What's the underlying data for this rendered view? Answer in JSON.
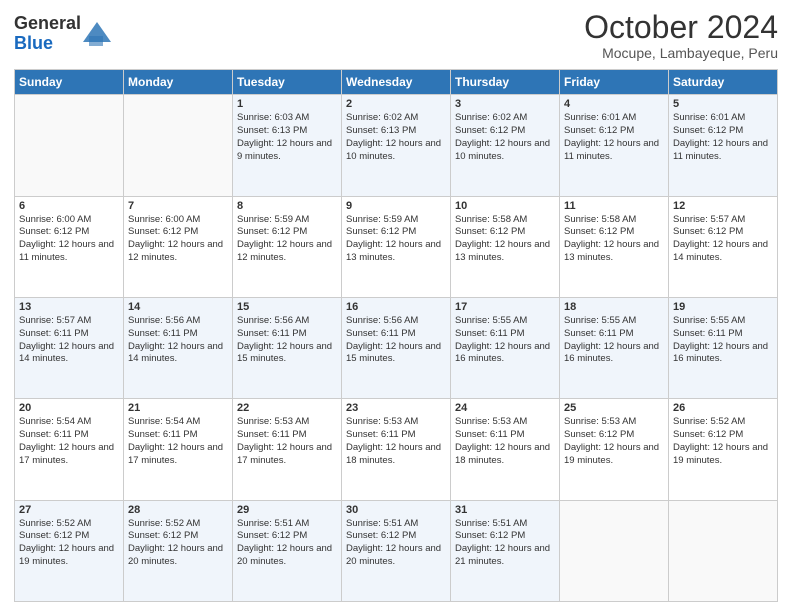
{
  "logo": {
    "general": "General",
    "blue": "Blue"
  },
  "header": {
    "title": "October 2024",
    "subtitle": "Mocupe, Lambayeque, Peru"
  },
  "weekdays": [
    "Sunday",
    "Monday",
    "Tuesday",
    "Wednesday",
    "Thursday",
    "Friday",
    "Saturday"
  ],
  "weeks": [
    [
      {
        "day": "",
        "info": ""
      },
      {
        "day": "",
        "info": ""
      },
      {
        "day": "1",
        "info": "Sunrise: 6:03 AM\nSunset: 6:13 PM\nDaylight: 12 hours and 9 minutes."
      },
      {
        "day": "2",
        "info": "Sunrise: 6:02 AM\nSunset: 6:13 PM\nDaylight: 12 hours and 10 minutes."
      },
      {
        "day": "3",
        "info": "Sunrise: 6:02 AM\nSunset: 6:12 PM\nDaylight: 12 hours and 10 minutes."
      },
      {
        "day": "4",
        "info": "Sunrise: 6:01 AM\nSunset: 6:12 PM\nDaylight: 12 hours and 11 minutes."
      },
      {
        "day": "5",
        "info": "Sunrise: 6:01 AM\nSunset: 6:12 PM\nDaylight: 12 hours and 11 minutes."
      }
    ],
    [
      {
        "day": "6",
        "info": "Sunrise: 6:00 AM\nSunset: 6:12 PM\nDaylight: 12 hours and 11 minutes."
      },
      {
        "day": "7",
        "info": "Sunrise: 6:00 AM\nSunset: 6:12 PM\nDaylight: 12 hours and 12 minutes."
      },
      {
        "day": "8",
        "info": "Sunrise: 5:59 AM\nSunset: 6:12 PM\nDaylight: 12 hours and 12 minutes."
      },
      {
        "day": "9",
        "info": "Sunrise: 5:59 AM\nSunset: 6:12 PM\nDaylight: 12 hours and 13 minutes."
      },
      {
        "day": "10",
        "info": "Sunrise: 5:58 AM\nSunset: 6:12 PM\nDaylight: 12 hours and 13 minutes."
      },
      {
        "day": "11",
        "info": "Sunrise: 5:58 AM\nSunset: 6:12 PM\nDaylight: 12 hours and 13 minutes."
      },
      {
        "day": "12",
        "info": "Sunrise: 5:57 AM\nSunset: 6:12 PM\nDaylight: 12 hours and 14 minutes."
      }
    ],
    [
      {
        "day": "13",
        "info": "Sunrise: 5:57 AM\nSunset: 6:11 PM\nDaylight: 12 hours and 14 minutes."
      },
      {
        "day": "14",
        "info": "Sunrise: 5:56 AM\nSunset: 6:11 PM\nDaylight: 12 hours and 14 minutes."
      },
      {
        "day": "15",
        "info": "Sunrise: 5:56 AM\nSunset: 6:11 PM\nDaylight: 12 hours and 15 minutes."
      },
      {
        "day": "16",
        "info": "Sunrise: 5:56 AM\nSunset: 6:11 PM\nDaylight: 12 hours and 15 minutes."
      },
      {
        "day": "17",
        "info": "Sunrise: 5:55 AM\nSunset: 6:11 PM\nDaylight: 12 hours and 16 minutes."
      },
      {
        "day": "18",
        "info": "Sunrise: 5:55 AM\nSunset: 6:11 PM\nDaylight: 12 hours and 16 minutes."
      },
      {
        "day": "19",
        "info": "Sunrise: 5:55 AM\nSunset: 6:11 PM\nDaylight: 12 hours and 16 minutes."
      }
    ],
    [
      {
        "day": "20",
        "info": "Sunrise: 5:54 AM\nSunset: 6:11 PM\nDaylight: 12 hours and 17 minutes."
      },
      {
        "day": "21",
        "info": "Sunrise: 5:54 AM\nSunset: 6:11 PM\nDaylight: 12 hours and 17 minutes."
      },
      {
        "day": "22",
        "info": "Sunrise: 5:53 AM\nSunset: 6:11 PM\nDaylight: 12 hours and 17 minutes."
      },
      {
        "day": "23",
        "info": "Sunrise: 5:53 AM\nSunset: 6:11 PM\nDaylight: 12 hours and 18 minutes."
      },
      {
        "day": "24",
        "info": "Sunrise: 5:53 AM\nSunset: 6:11 PM\nDaylight: 12 hours and 18 minutes."
      },
      {
        "day": "25",
        "info": "Sunrise: 5:53 AM\nSunset: 6:12 PM\nDaylight: 12 hours and 19 minutes."
      },
      {
        "day": "26",
        "info": "Sunrise: 5:52 AM\nSunset: 6:12 PM\nDaylight: 12 hours and 19 minutes."
      }
    ],
    [
      {
        "day": "27",
        "info": "Sunrise: 5:52 AM\nSunset: 6:12 PM\nDaylight: 12 hours and 19 minutes."
      },
      {
        "day": "28",
        "info": "Sunrise: 5:52 AM\nSunset: 6:12 PM\nDaylight: 12 hours and 20 minutes."
      },
      {
        "day": "29",
        "info": "Sunrise: 5:51 AM\nSunset: 6:12 PM\nDaylight: 12 hours and 20 minutes."
      },
      {
        "day": "30",
        "info": "Sunrise: 5:51 AM\nSunset: 6:12 PM\nDaylight: 12 hours and 20 minutes."
      },
      {
        "day": "31",
        "info": "Sunrise: 5:51 AM\nSunset: 6:12 PM\nDaylight: 12 hours and 21 minutes."
      },
      {
        "day": "",
        "info": ""
      },
      {
        "day": "",
        "info": ""
      }
    ]
  ]
}
